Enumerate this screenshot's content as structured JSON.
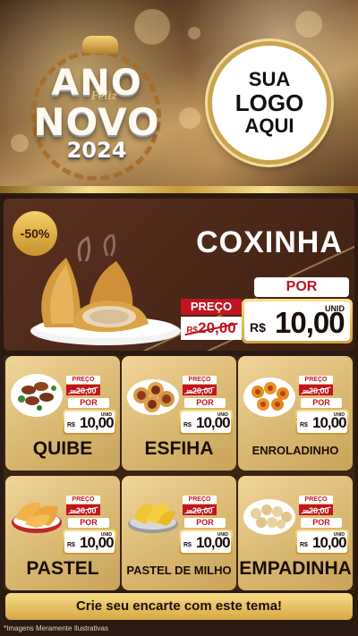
{
  "header": {
    "new_year": {
      "line1": "ANO",
      "script": "Feliz",
      "line2": "NOVO",
      "year": "2024"
    },
    "logo_placeholder": {
      "line1": "SUA",
      "line2": "LOGO",
      "line3": "AQUI"
    }
  },
  "hero": {
    "discount_badge": "-50%",
    "product_name": "COXINHA",
    "old_price": {
      "label": "PREÇO",
      "currency": "R$",
      "amount": "20,00"
    },
    "new_price": {
      "label": "POR",
      "unit": "UNID",
      "currency": "R$",
      "amount": "10,00"
    }
  },
  "products": [
    {
      "name": "QUIBE",
      "old_label": "PREÇO",
      "old_currency": "R$",
      "old_amount": "20,00",
      "por": "POR",
      "unit": "UNID",
      "currency": "R$",
      "amount": "10,00"
    },
    {
      "name": "ESFIHA",
      "old_label": "PREÇO",
      "old_currency": "R$",
      "old_amount": "20,00",
      "por": "POR",
      "unit": "UNID",
      "currency": "R$",
      "amount": "10,00"
    },
    {
      "name": "ENROLADINHO",
      "old_label": "PREÇO",
      "old_currency": "R$",
      "old_amount": "20,00",
      "por": "POR",
      "unit": "UNID",
      "currency": "R$",
      "amount": "10,00"
    },
    {
      "name": "PASTEL",
      "old_label": "PREÇO",
      "old_currency": "R$",
      "old_amount": "20,00",
      "por": "POR",
      "unit": "UNID",
      "currency": "R$",
      "amount": "10,00"
    },
    {
      "name": "PASTEL DE MILHO",
      "old_label": "PREÇO",
      "old_currency": "R$",
      "old_amount": "20,00",
      "por": "POR",
      "unit": "UNID",
      "currency": "R$",
      "amount": "10,00"
    },
    {
      "name": "EMPADINHA",
      "old_label": "PREÇO",
      "old_currency": "R$",
      "old_amount": "20,00",
      "por": "POR",
      "unit": "UNID",
      "currency": "R$",
      "amount": "10,00"
    }
  ],
  "footer": {
    "cta": "Crie seu encarte com este tema!",
    "disclaimer": "*Imagens Meramente Ilustrativas"
  },
  "colors": {
    "gold": "#d6a845",
    "red": "#c0151f",
    "brown": "#4a2718",
    "card": "#e2c483"
  }
}
